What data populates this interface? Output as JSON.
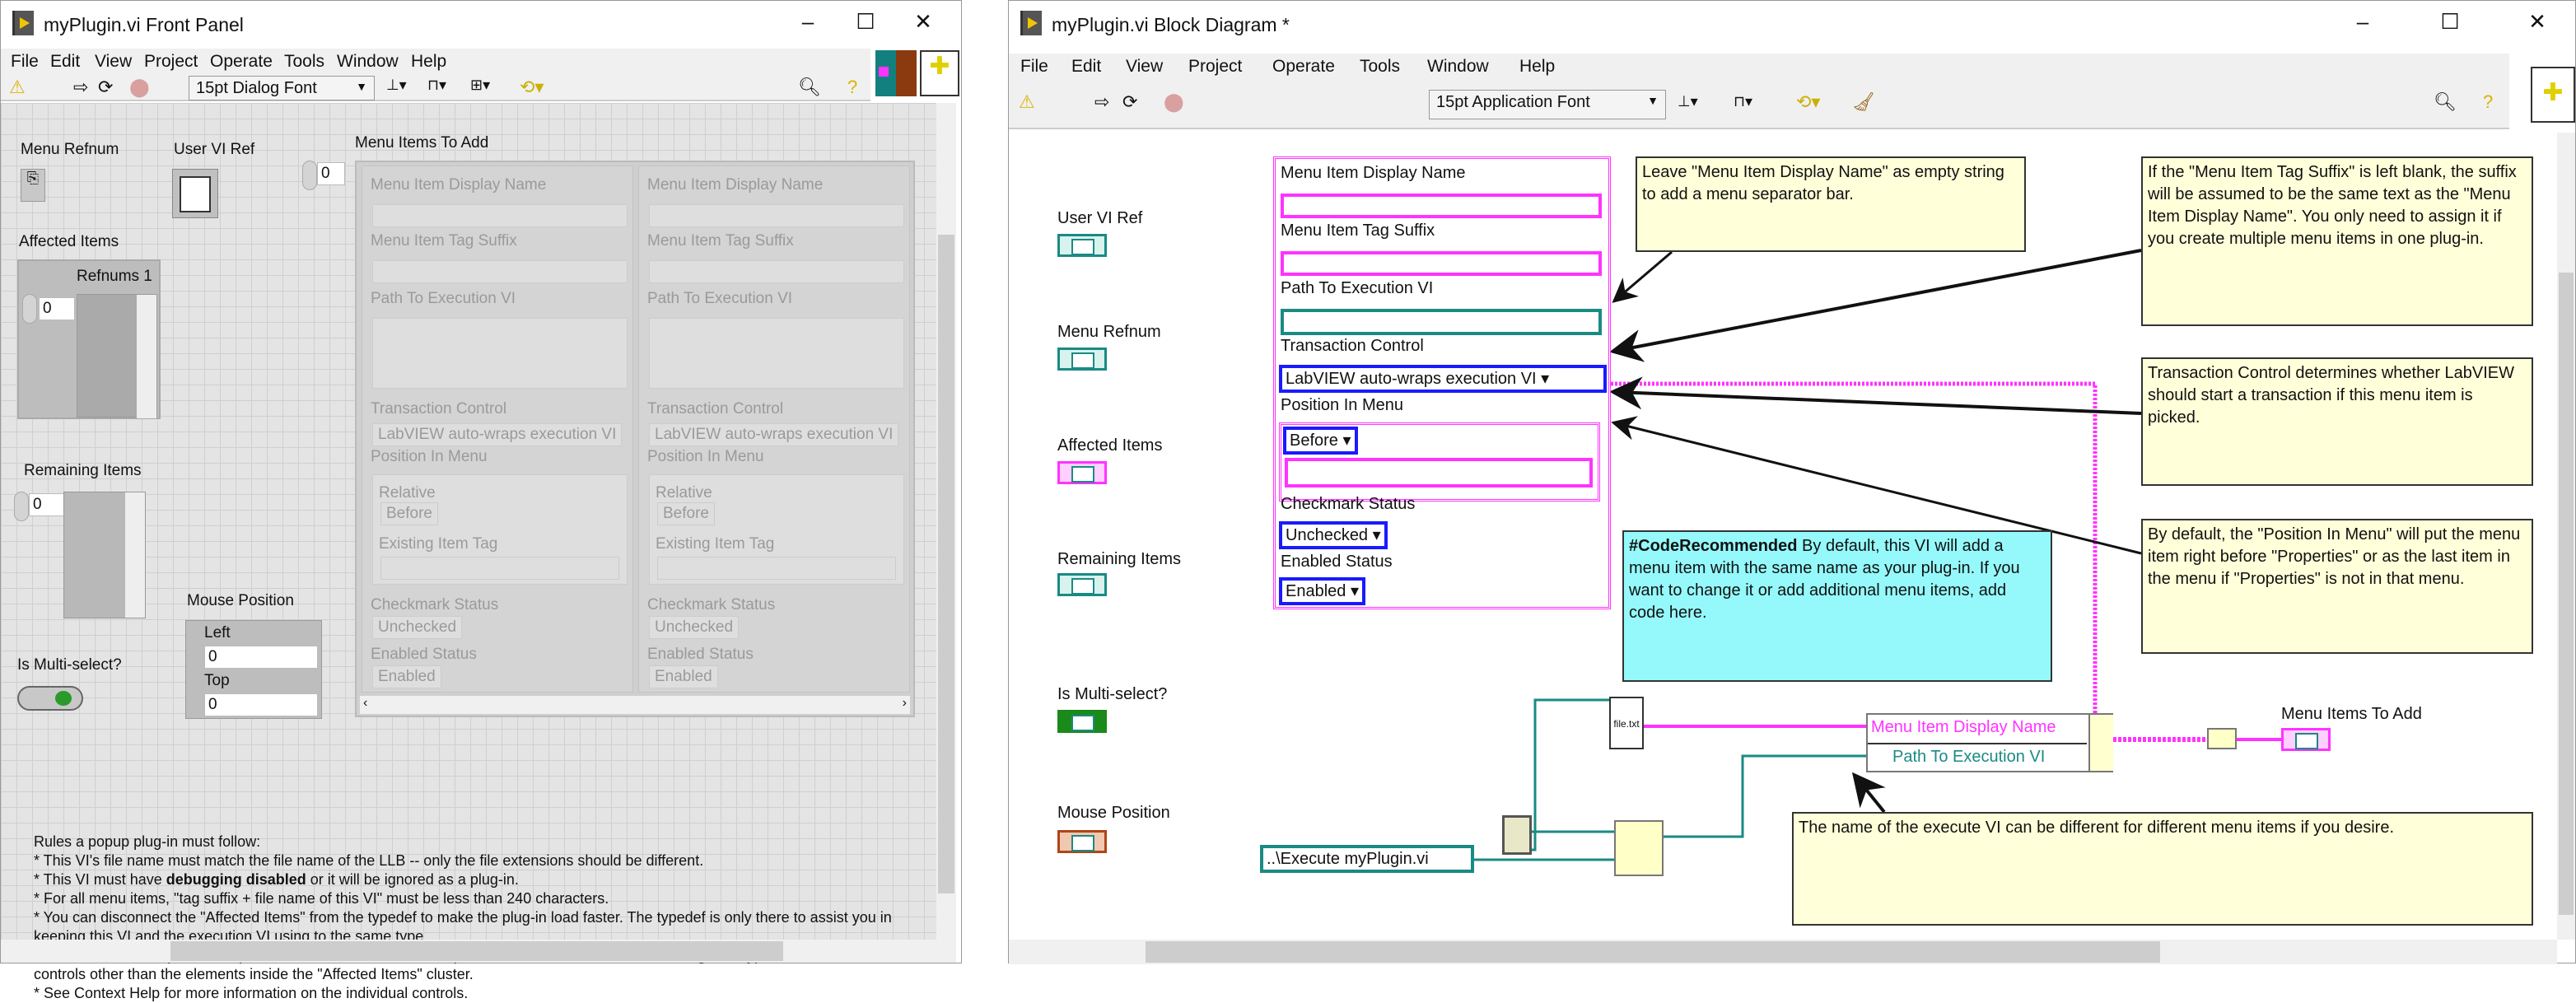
{
  "front_panel": {
    "title": "myPlugin.vi Front Panel",
    "menu": [
      "File",
      "Edit",
      "View",
      "Project",
      "Operate",
      "Tools",
      "Window",
      "Help"
    ],
    "font": "15pt Dialog Font",
    "menu_refnum_label": "Menu Refnum",
    "user_vi_ref_label": "User VI Ref",
    "affected_items": {
      "label": "Affected Items",
      "inner_label": "Refnums 1",
      "index": "0"
    },
    "remaining_items": {
      "label": "Remaining Items",
      "index": "0"
    },
    "mouse_position": {
      "label": "Mouse Position",
      "left_label": "Left",
      "left": "0",
      "top_label": "Top",
      "top": "0"
    },
    "multi_select_label": "Is Multi-select?",
    "menu_items": {
      "label": "Menu Items To Add",
      "index": "0",
      "elements": [
        {
          "display_name_label": "Menu Item Display Name",
          "tag_suffix_label": "Menu Item Tag Suffix",
          "path_label": "Path To Execution VI",
          "transaction_label": "Transaction Control",
          "transaction": "LabVIEW auto-wraps execution VI",
          "position_label": "Position In Menu",
          "relative_label": "Relative",
          "relative": "Before",
          "existing_tag_label": "Existing Item Tag",
          "checkmark_label": "Checkmark Status",
          "checkmark": "Unchecked",
          "enabled_label": "Enabled Status",
          "enabled": "Enabled"
        },
        {
          "display_name_label": "Menu Item Display Name",
          "tag_suffix_label": "Menu Item Tag Suffix",
          "path_label": "Path To Execution VI",
          "transaction_label": "Transaction Control",
          "transaction": "LabVIEW auto-wraps execution VI",
          "position_label": "Position In Menu",
          "relative_label": "Relative",
          "relative": "Before",
          "existing_tag_label": "Existing Item Tag",
          "checkmark_label": "Checkmark Status",
          "checkmark": "Unchecked",
          "enabled_label": "Enabled Status",
          "enabled": "Enabled"
        }
      ]
    },
    "rules": {
      "heading": "Rules a popup plug-in must follow:",
      "l1": "* This VI's file name must match the file name of the LLB -- only the file extensions should be different.",
      "l2a": "* This VI must have ",
      "l2b": "debugging disabled",
      "l2c": " or it will be ignored as a plug-in.",
      "l3": "* For all menu items, \"tag suffix + file name of this VI\" must be less than 240 characters.",
      "l4": "* You can disconnect the \"Affected Items\" from the typedef to make the plug-in load faster. The typedef is only there to assist you in keeping this VI and the execution VI using to the same type.",
      "l5": "* All controls on this panel except \"Affected Items\" are locked to prevent accidental edits. Do not change the types or the names of controls other than the elements inside the \"Affected Items\" cluster.",
      "l6": "* See Context Help for more information on the individual controls."
    }
  },
  "block_diagram": {
    "title": "myPlugin.vi Block Diagram *",
    "menu": [
      "File",
      "Edit",
      "View",
      "Project",
      "Operate",
      "Tools",
      "Window",
      "Help"
    ],
    "font": "15pt Application Font",
    "terminals": [
      "User VI Ref",
      "Menu Refnum",
      "Affected Items",
      "Remaining Items",
      "Is Multi-select?",
      "Mouse Position"
    ],
    "cluster": {
      "display_name_label": "Menu Item Display Name",
      "tag_suffix_label": "Menu Item Tag Suffix",
      "path_label": "Path To Execution VI",
      "transaction_label": "Transaction Control",
      "transaction": "LabVIEW auto-wraps execution VI",
      "position_label": "Position In Menu",
      "relative": "Before",
      "checkmark_label": "Checkmark Status",
      "checkmark": "Unchecked",
      "enabled_label": "Enabled Status",
      "enabled": "Enabled"
    },
    "notes": {
      "n1": "Leave \"Menu Item Display Name\" as empty string to add a menu separator bar.",
      "n2": "If the \"Menu Item Tag Suffix\" is left blank, the suffix will be assumed to be the same text as the \"Menu Item Display Name\". You only need to assign it if you create multiple menu items in one plug-in.",
      "n3": "Transaction Control determines whether LabVIEW should start a transaction if this menu item is picked.",
      "n4": "By default, the \"Position In Menu\" will put the menu item right before \"Properties\" or as the last item in the menu if \"Properties\" is not in that menu.",
      "code_tag": "#CodeRecommended",
      "code_text": " By default, this VI will add a menu item with the same name as your plug-in. If you want to change it or add additional menu items, add code here.",
      "n5": "The name of the execute VI can be different for different menu items if you desire."
    },
    "file_constant": "file.txt",
    "bundle": {
      "row1": "Menu Item Display Name",
      "row2": "Path To Execution VI"
    },
    "path_constant": "..\\Execute myPlugin.vi",
    "output_label": "Menu Items To Add",
    "colors": {
      "string": "#ff33ff",
      "path": "#1a8a84",
      "enum": "#1a1aff",
      "note": "#ffffd9",
      "code_note": "#95f9fb"
    }
  }
}
